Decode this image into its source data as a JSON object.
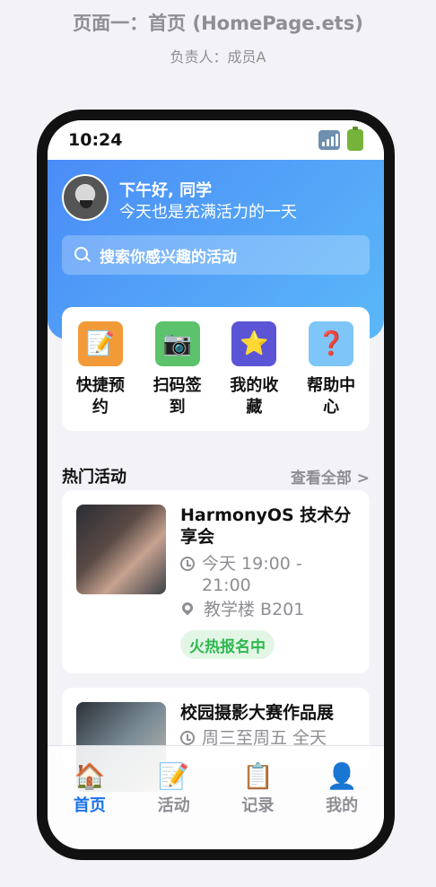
{
  "page": {
    "title": "页面一：首页 (HomePage.ets)",
    "subtitle": "负责人：成员A"
  },
  "status_bar": {
    "time": "10:24",
    "icons": [
      "signal-icon",
      "battery-icon"
    ]
  },
  "header": {
    "greeting": "下午好, 同学",
    "tagline": "今天也是充满活力的一天"
  },
  "search": {
    "placeholder": "搜索你感兴趣的活动"
  },
  "quick_actions": [
    {
      "label": "快捷预约",
      "icon": "memo-icon",
      "glyph": "📝",
      "color": "#f29a38"
    },
    {
      "label": "扫码签到",
      "icon": "camera-icon",
      "glyph": "📷",
      "color": "#5cc26b"
    },
    {
      "label": "我的收藏",
      "icon": "star-icon",
      "glyph": "⭐",
      "color": "#5b55d6"
    },
    {
      "label": "帮助中心",
      "icon": "question-icon",
      "glyph": "❓",
      "color": "#7ec6f7"
    }
  ],
  "section": {
    "title": "热门活动",
    "more_label": "查看全部 >"
  },
  "activities": [
    {
      "title": "HarmonyOS 技术分享会",
      "time": "今天 19:00 - 21:00",
      "location": "教学楼 B201",
      "tag": "火热报名中"
    },
    {
      "title": "校园摄影大赛作品展",
      "time": "周三至周五 全天"
    }
  ],
  "tabs": [
    {
      "label": "首页",
      "icon": "house-icon",
      "glyph": "🏠",
      "active": true
    },
    {
      "label": "活动",
      "icon": "memo-icon",
      "glyph": "📝",
      "active": false
    },
    {
      "label": "记录",
      "icon": "clipboard-icon",
      "glyph": "📋",
      "active": false
    },
    {
      "label": "我的",
      "icon": "person-icon",
      "glyph": "👤",
      "active": false
    }
  ],
  "colors": {
    "accent": "#1a73e8",
    "hero_start": "#4a8cf7",
    "hero_end": "#5bb8f8",
    "tag_text": "#2fb84e",
    "tag_bg": "#e3f6e6"
  }
}
